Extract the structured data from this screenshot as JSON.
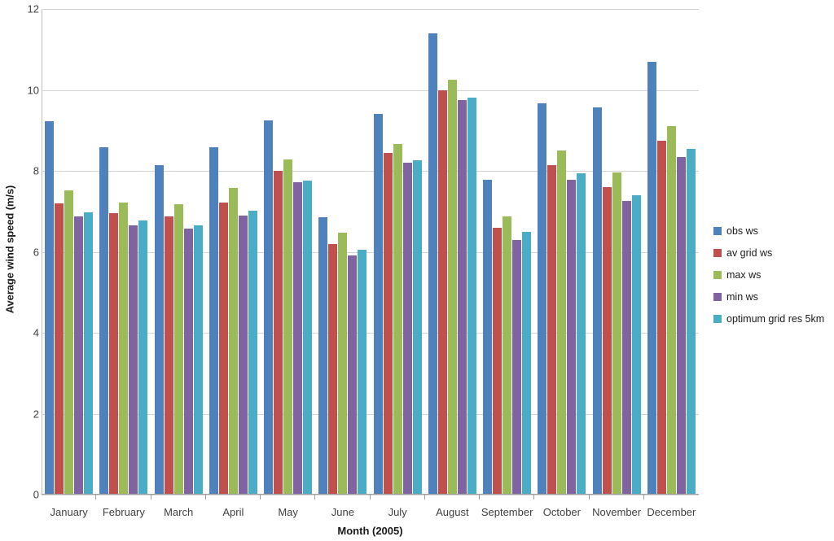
{
  "chart_data": {
    "type": "bar",
    "title": "",
    "xlabel": "Month (2005)",
    "ylabel": "Average wind speed (m/s)",
    "categories": [
      "January",
      "February",
      "March",
      "April",
      "May",
      "June",
      "July",
      "August",
      "September",
      "October",
      "November",
      "December"
    ],
    "series": [
      {
        "name": "obs ws",
        "color": "#4F81BD",
        "values": [
          9.22,
          8.58,
          8.15,
          8.58,
          9.25,
          6.85,
          9.4,
          11.4,
          7.78,
          9.67,
          9.57,
          10.7
        ]
      },
      {
        "name": "av grid ws",
        "color": "#C0504D",
        "values": [
          7.2,
          6.95,
          6.88,
          7.22,
          8.0,
          6.2,
          8.45,
          10.0,
          6.6,
          8.15,
          7.6,
          8.75
        ]
      },
      {
        "name": "max ws",
        "color": "#9BBB59",
        "values": [
          7.52,
          7.22,
          7.17,
          7.58,
          8.28,
          6.48,
          8.67,
          10.25,
          6.87,
          8.5,
          7.97,
          9.1
        ]
      },
      {
        "name": "min ws",
        "color": "#8064A2",
        "values": [
          6.87,
          6.65,
          6.57,
          6.9,
          7.72,
          5.9,
          8.2,
          9.75,
          6.3,
          7.78,
          7.25,
          8.35
        ]
      },
      {
        "name": "optimum grid res 5km",
        "color": "#4BACC6",
        "values": [
          6.97,
          6.77,
          6.65,
          7.02,
          7.75,
          6.05,
          8.27,
          9.8,
          6.5,
          7.95,
          7.4,
          8.55
        ]
      }
    ],
    "ylim": [
      0,
      12
    ],
    "y_ticks": [
      0,
      2,
      4,
      6,
      8,
      10,
      12
    ],
    "y_tick_labels": [
      "0",
      "2",
      "4",
      "6",
      "8",
      "10",
      "12"
    ],
    "grid": "horizontal",
    "legend_position": "right",
    "colors": {
      "obs_ws": "#4F81BD",
      "av_grid_ws": "#C0504D",
      "max_ws": "#9BBB59",
      "min_ws": "#8064A2",
      "optimum_grid_res_5km": "#4BACC6",
      "gridline": "#D3D3D3",
      "axis": "#9E9E9E",
      "tick_text": "#3F3F3F",
      "title_text": "#1A1A1A",
      "background": "#FFFFFF"
    }
  }
}
